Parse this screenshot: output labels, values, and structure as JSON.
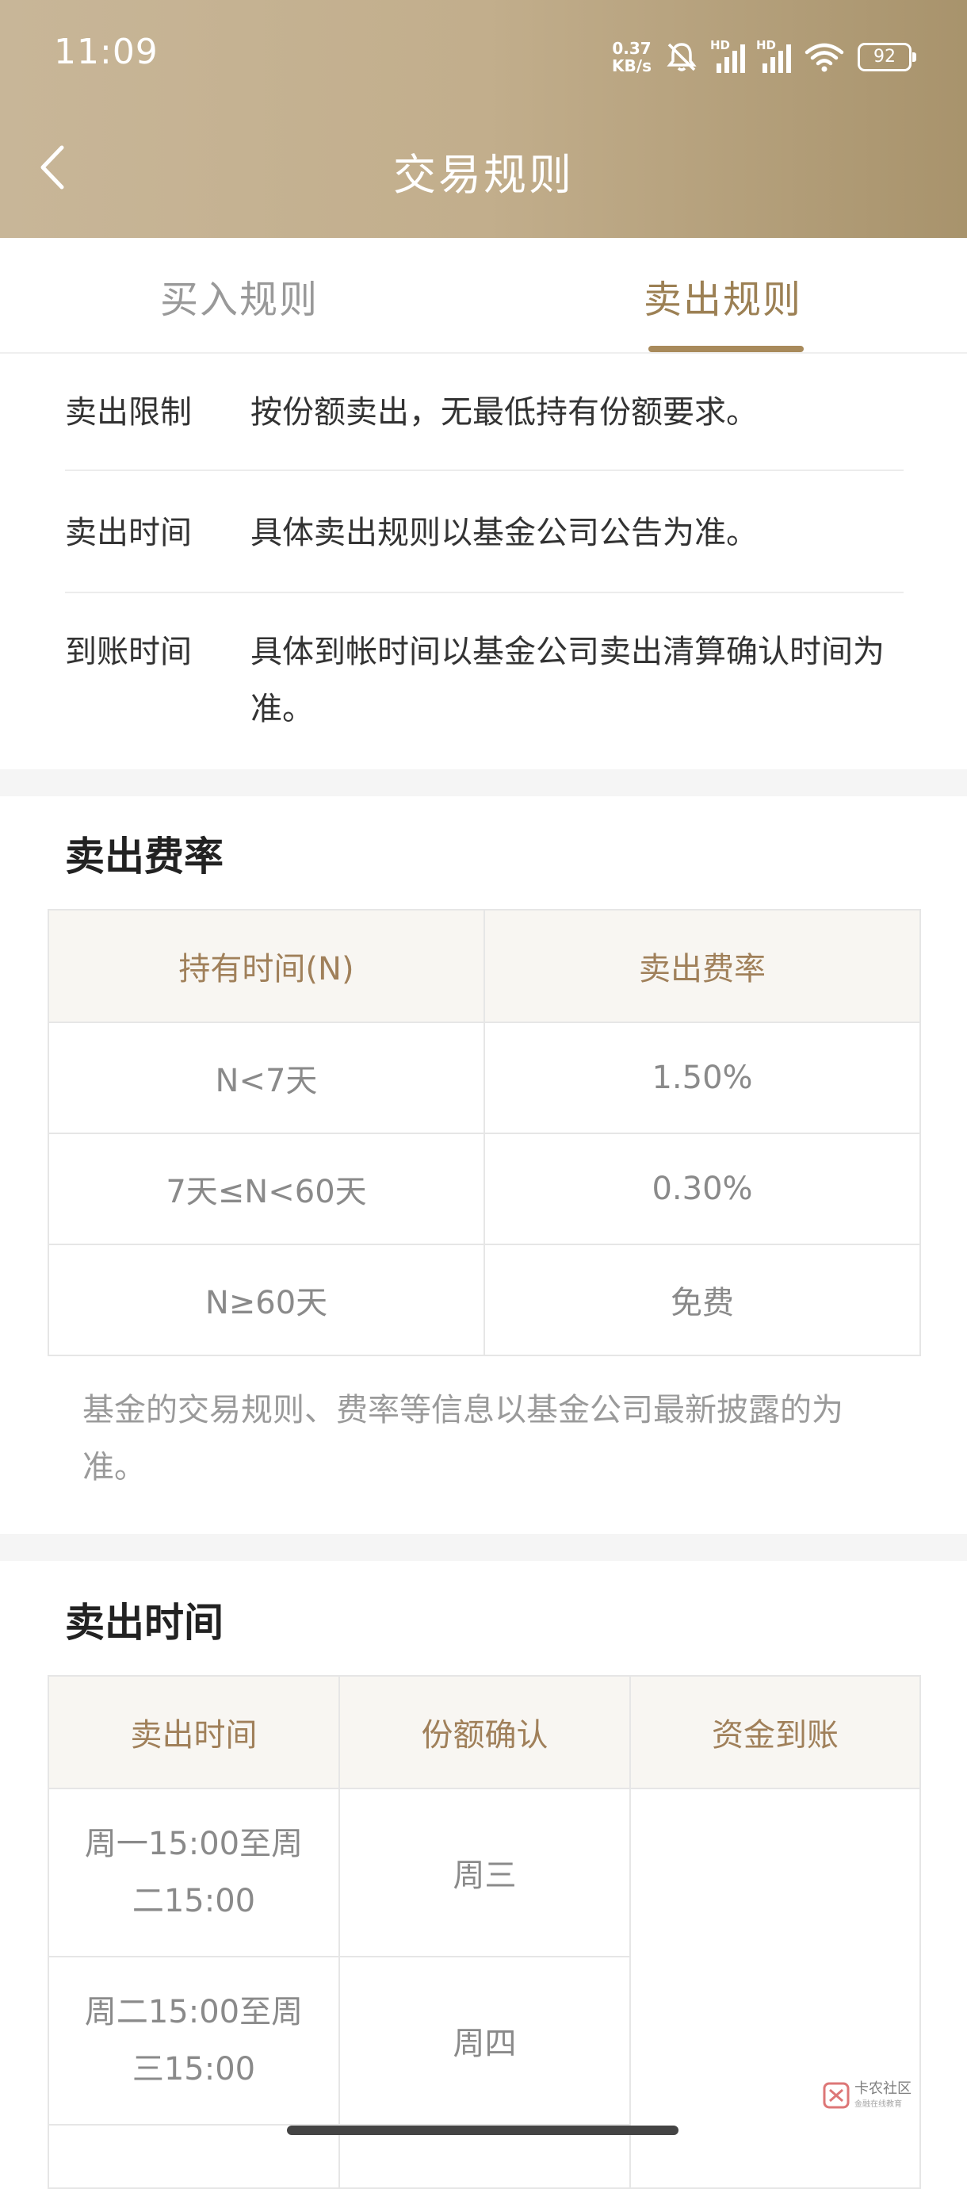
{
  "status_bar": {
    "time": "11:09",
    "net_speed_value": "0.37",
    "net_speed_unit": "KB/s",
    "hd1": "HD",
    "hd2": "HD",
    "battery": "92"
  },
  "header": {
    "title": "交易规则",
    "back_icon": "chevron-left-icon"
  },
  "tabs": {
    "buy": "买入规则",
    "sell": "卖出规则",
    "active": "sell"
  },
  "rules": [
    {
      "label": "卖出限制",
      "value": "按份额卖出，无最低持有份额要求。"
    },
    {
      "label": "卖出时间",
      "value": "具体卖出规则以基金公司公告为准。"
    },
    {
      "label": "到账时间",
      "value": "具体到帐时间以基金公司卖出清算确认时间为准。"
    }
  ],
  "fee_section": {
    "title": "卖出费率",
    "headers": [
      "持有时间(N)",
      "卖出费率"
    ],
    "rows": [
      [
        "N<7天",
        "1.50%"
      ],
      [
        "7天≤N<60天",
        "0.30%"
      ],
      [
        "N≥60天",
        "免费"
      ]
    ],
    "note": "基金的交易规则、费率等信息以基金公司最新披露的为准。"
  },
  "time_section": {
    "title": "卖出时间",
    "headers": [
      "卖出时间",
      "份额确认",
      "资金到账"
    ],
    "rows": [
      {
        "sell_time": "周一15:00至周二15:00",
        "confirm": "周三"
      },
      {
        "sell_time": "周二15:00至周三15:00",
        "confirm": "周四"
      }
    ]
  },
  "watermark": {
    "text": "卡农社区",
    "sub": "金融在线教育"
  },
  "colors": {
    "header_gradient_start": "#c8b698",
    "header_gradient_end": "#a8936c",
    "accent": "#9c8054",
    "table_header_bg": "#f8f6f2"
  }
}
